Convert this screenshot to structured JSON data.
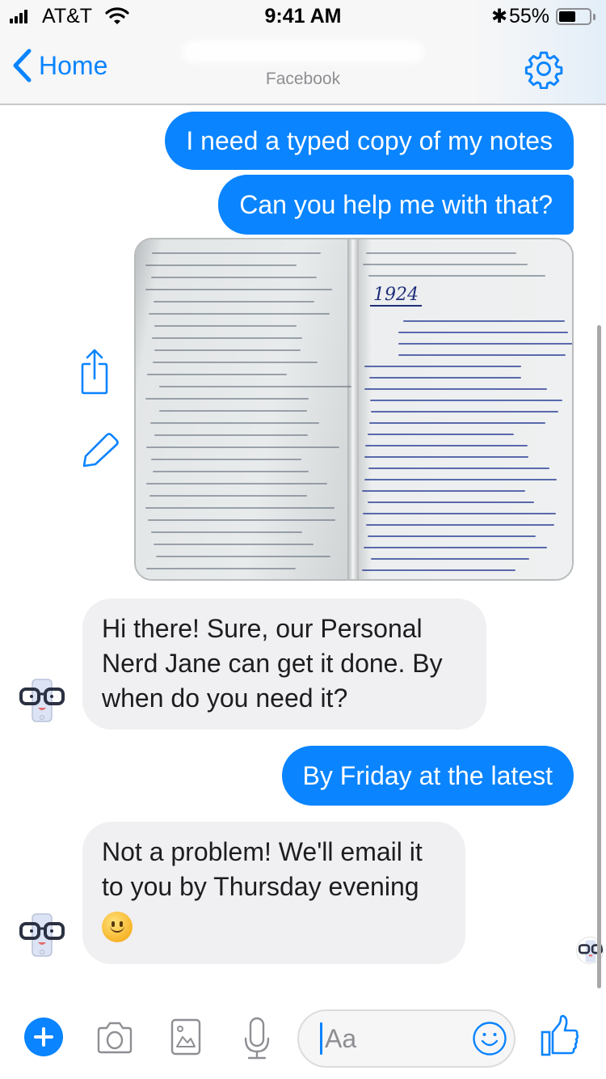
{
  "status_bar": {
    "carrier": "AT&T",
    "time": "9:41 AM",
    "battery_percent": "55%",
    "battery_level": 0.55
  },
  "nav": {
    "back_label": "Home",
    "subtitle": "Facebook",
    "icons": {
      "back": "chevron-left-icon",
      "settings": "gear-icon"
    }
  },
  "colors": {
    "accent": "#0a84ff",
    "incoming_bubble": "#f0eff1",
    "outgoing_text": "#ffffff",
    "incoming_text": "#1d1d1f"
  },
  "messages": [
    {
      "sender": "me",
      "type": "text",
      "text": "I need a typed copy of my notes"
    },
    {
      "sender": "me",
      "type": "text",
      "text": "Can you help me with that?"
    },
    {
      "sender": "me",
      "type": "image",
      "alt": "Photo of handwritten notebook pages dated 1924",
      "caption_visible": "1924"
    },
    {
      "sender": "bot",
      "type": "text",
      "text": "Hi there! Sure, our Personal Nerd Jane can get it done. By when do you need it?"
    },
    {
      "sender": "me",
      "type": "text",
      "text": "By Friday at the latest"
    },
    {
      "sender": "bot",
      "type": "text",
      "text": "Not a problem! We'll email it to you by Thursday evening",
      "emoji": "slightly-smiling-face"
    }
  ],
  "image_actions": {
    "share": "share-icon",
    "edit": "pencil-icon"
  },
  "composer": {
    "placeholder": "Aa",
    "icons": [
      "plus-icon",
      "camera-icon",
      "image-icon",
      "microphone-icon",
      "emoji-icon",
      "thumbs-up-icon"
    ]
  }
}
